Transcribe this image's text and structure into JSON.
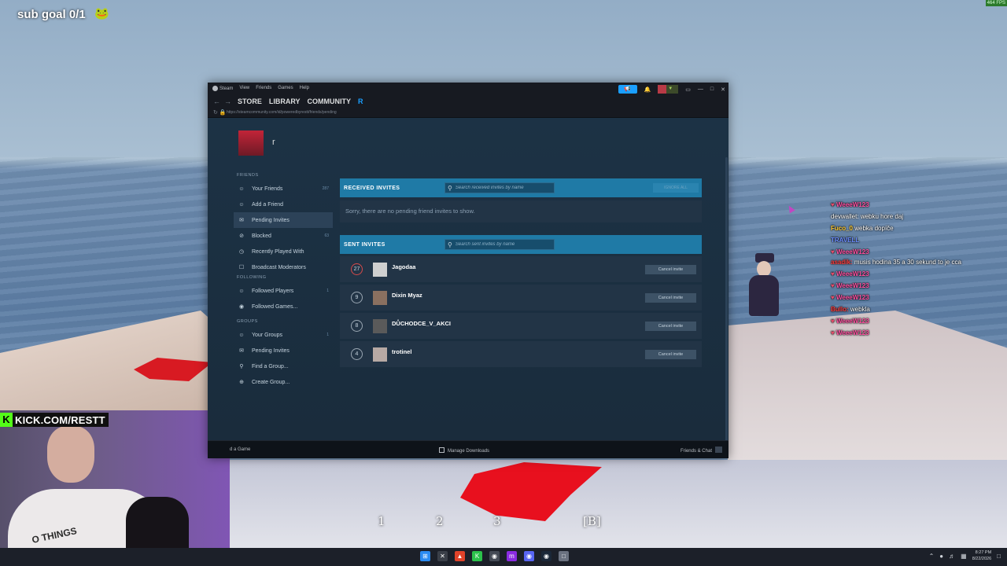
{
  "overlay": {
    "sub_goal": "sub goal 0/1",
    "fps": "464 FPS",
    "kick_banner": "KICK.COM/RESTT",
    "shirt_text": "O THINGS"
  },
  "chat": [
    {
      "user": "WeeeW123",
      "color": "pink",
      "text": ""
    },
    {
      "user": "devwallet:",
      "color": "white",
      "text": "webku hore daj"
    },
    {
      "user": "Fuco_0",
      "color": "yellow",
      "text": "webka dopíče"
    },
    {
      "user": "TRAVELL",
      "color": "blue",
      "text": ""
    },
    {
      "user": "WeeeW123",
      "color": "pink",
      "text": ""
    },
    {
      "user": "asadik:",
      "color": "red",
      "text": "musis hodina 35 a 30 sekund to je cca"
    },
    {
      "user": "WeeeW123",
      "color": "pink",
      "text": ""
    },
    {
      "user": "WeeeW123",
      "color": "pink",
      "text": ""
    },
    {
      "user": "WeeeW123",
      "color": "pink",
      "text": ""
    },
    {
      "user": "Bullo:",
      "color": "red",
      "text": "webkla"
    },
    {
      "user": "WeeeW123",
      "color": "pink",
      "text": ""
    },
    {
      "user": "WeeeW123",
      "color": "pink",
      "text": ""
    }
  ],
  "hotbar": {
    "slots": [
      "1",
      "2",
      "3",
      "[B]"
    ]
  },
  "steam": {
    "menu": [
      "Steam",
      "View",
      "Friends",
      "Games",
      "Help"
    ],
    "nav": {
      "store": "STORE",
      "library": "LIBRARY",
      "community": "COMMUNITY",
      "user": "R"
    },
    "url": "https://steamcommunity.com/id/poweredbyrestt/friends/pending",
    "profile_name": "r",
    "sidebar": {
      "friends_header": "FRIENDS",
      "friends_items": [
        {
          "label": "Your Friends",
          "count": "287",
          "icon": "person-icon"
        },
        {
          "label": "Add a Friend",
          "count": "",
          "icon": "add-person-icon"
        },
        {
          "label": "Pending Invites",
          "count": "",
          "icon": "envelope-icon"
        },
        {
          "label": "Blocked",
          "count": "63",
          "icon": "blocked-icon"
        },
        {
          "label": "Recently Played With",
          "count": "",
          "icon": "clock-icon"
        },
        {
          "label": "Broadcast Moderators",
          "count": "",
          "icon": "broadcast-icon"
        }
      ],
      "following_header": "FOLLOWING",
      "following_items": [
        {
          "label": "Followed Players",
          "count": "1",
          "icon": "person-check-icon"
        },
        {
          "label": "Followed Games...",
          "count": "",
          "icon": "controller-icon"
        }
      ],
      "groups_header": "GROUPS",
      "groups_items": [
        {
          "label": "Your Groups",
          "count": "1",
          "icon": "group-icon"
        },
        {
          "label": "Pending Invites",
          "count": "",
          "icon": "envelope-icon"
        },
        {
          "label": "Find a Group...",
          "count": "",
          "icon": "search-icon"
        },
        {
          "label": "Create Group...",
          "count": "",
          "icon": "plus-circle-icon"
        }
      ]
    },
    "received": {
      "title": "RECEIVED INVITES",
      "search_placeholder": "Search received invites by name",
      "ignore_all": "IGNORE ALL",
      "empty_message": "Sorry, there are no pending friend invites to show."
    },
    "sent": {
      "title": "SENT INVITES",
      "search_placeholder": "Search sent invites by name",
      "cancel_label": "Cancel invite",
      "invites": [
        {
          "level": "27",
          "name": "Jagodaa"
        },
        {
          "level": "9",
          "name": "Dixin Myaz"
        },
        {
          "level": "8",
          "name": "DŮCHODCE_V_AKCI"
        },
        {
          "level": "4",
          "name": "trotinel"
        }
      ]
    },
    "bottom": {
      "left": "d a Game",
      "middle": "Manage Downloads",
      "right": "Friends & Chat"
    }
  },
  "taskbar": {
    "time": "8:27 PM",
    "date": "8/22/2026"
  }
}
